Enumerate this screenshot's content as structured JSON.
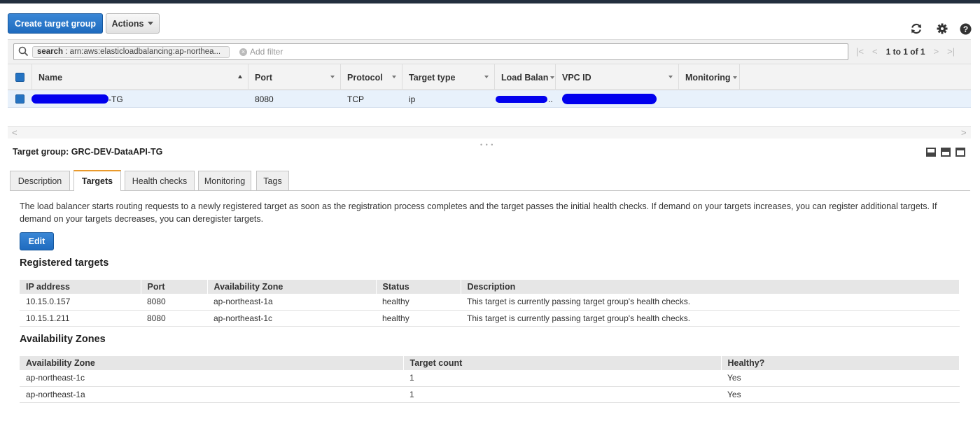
{
  "toolbar": {
    "create_label": "Create target group",
    "actions_label": "Actions"
  },
  "icons": {
    "refresh": "refresh-icon",
    "settings": "gear-icon",
    "help": "help-icon"
  },
  "search": {
    "token_key": "search",
    "token_value": " : arn:aws:elasticloadbalancing:ap-northea...",
    "placeholder": "Add filter",
    "pager_text": "1 to 1 of 1"
  },
  "grid": {
    "columns": [
      "Name",
      "Port",
      "Protocol",
      "Target type",
      "Load Balan",
      "VPC ID",
      "Monitoring"
    ],
    "row": {
      "name_suffix": "-TG",
      "port": "8080",
      "protocol": "TCP",
      "target_type": "ip",
      "lb_suffix": ".."
    }
  },
  "detail": {
    "title": "Target group: GRC-DEV-DataAPI-TG",
    "tabs": [
      "Description",
      "Targets",
      "Health checks",
      "Monitoring",
      "Tags"
    ],
    "active_tab": "Targets",
    "description": "The load balancer starts routing requests to a newly registered target as soon as the registration process completes and the target passes the initial health checks. If demand on your targets increases, you can register additional targets. If demand on your targets decreases, you can deregister targets.",
    "edit_label": "Edit",
    "registered_title": "Registered targets",
    "registered_columns": [
      "IP address",
      "Port",
      "Availability Zone",
      "Status",
      "Description"
    ],
    "registered_rows": [
      [
        "10.15.0.157",
        "8080",
        "ap-northeast-1a",
        "healthy",
        "This target is currently passing target group's health checks."
      ],
      [
        "10.15.1.211",
        "8080",
        "ap-northeast-1c",
        "healthy",
        "This target is currently passing target group's health checks."
      ]
    ],
    "az_title": "Availability Zones",
    "az_columns": [
      "Availability Zone",
      "Target count",
      "Healthy?"
    ],
    "az_rows": [
      [
        "ap-northeast-1c",
        "1",
        "Yes"
      ],
      [
        "ap-northeast-1a",
        "1",
        "Yes"
      ]
    ]
  },
  "colors": {
    "primary": "#1f6bbf",
    "active_tab_accent": "#e99a2d",
    "selected_row": "#e8f1fb",
    "redaction": "#0000ee"
  }
}
